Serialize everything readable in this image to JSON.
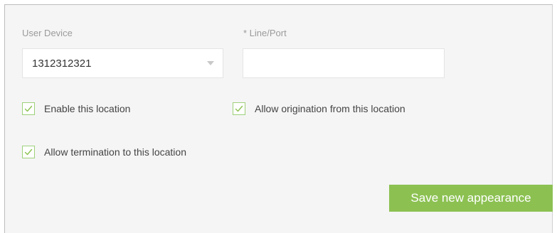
{
  "form": {
    "user_device": {
      "label": "User Device",
      "selected_value": "1312312321"
    },
    "line_port": {
      "label": "* Line/Port",
      "value": ""
    },
    "checkboxes": [
      {
        "label": "Enable this location",
        "checked": true
      },
      {
        "label": "Allow origination from this location",
        "checked": true
      },
      {
        "label": "Allow termination to this location",
        "checked": true
      }
    ],
    "save_label": "Save new appearance"
  },
  "colors": {
    "accent_green": "#8cc152",
    "checkbox_border": "#9ed07a",
    "panel_background": "#f5f5f5"
  },
  "icons": {
    "select_arrow": "chevron-down-icon",
    "check": "checkmark-icon"
  }
}
